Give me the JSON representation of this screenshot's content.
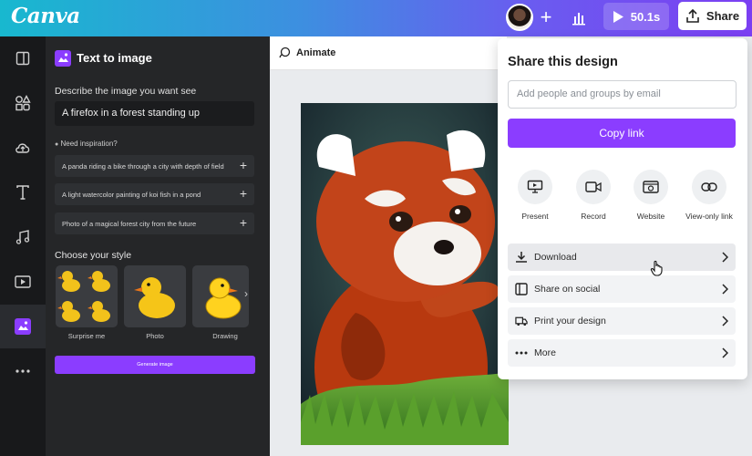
{
  "app": {
    "name": "Canva",
    "brand_purple": "#8b3dff"
  },
  "topbar": {
    "timer_label": "50.1s",
    "share_label": "Share"
  },
  "rail": {
    "items": [
      "layout-icon",
      "elements-icon",
      "uploads-icon",
      "text-icon",
      "audio-icon",
      "videos-icon",
      "text-to-image-icon",
      "more-icon"
    ]
  },
  "panel": {
    "title": "Text to image",
    "describe_label": "Describe the image you want see",
    "prompt_value": "A firefox in a forest standing up",
    "inspiration_label": "Need inspiration?",
    "suggestions": [
      "A panda riding a bike through a city with depth of field",
      "A light watercolor painting of koi fish in a pond",
      "Photo of a magical forest city from the future"
    ],
    "style_label": "Choose your style",
    "styles": [
      "Surprise me",
      "Photo",
      "Drawing"
    ],
    "generate_label": "Generate image"
  },
  "editor": {
    "animate_label": "Animate"
  },
  "share_panel": {
    "title": "Share this design",
    "input_placeholder": "Add people and groups by email",
    "copy_link_label": "Copy link",
    "options": [
      "Present",
      "Record",
      "Website",
      "View-only link"
    ],
    "rows": [
      "Download",
      "Share on social",
      "Print your design",
      "More"
    ]
  }
}
